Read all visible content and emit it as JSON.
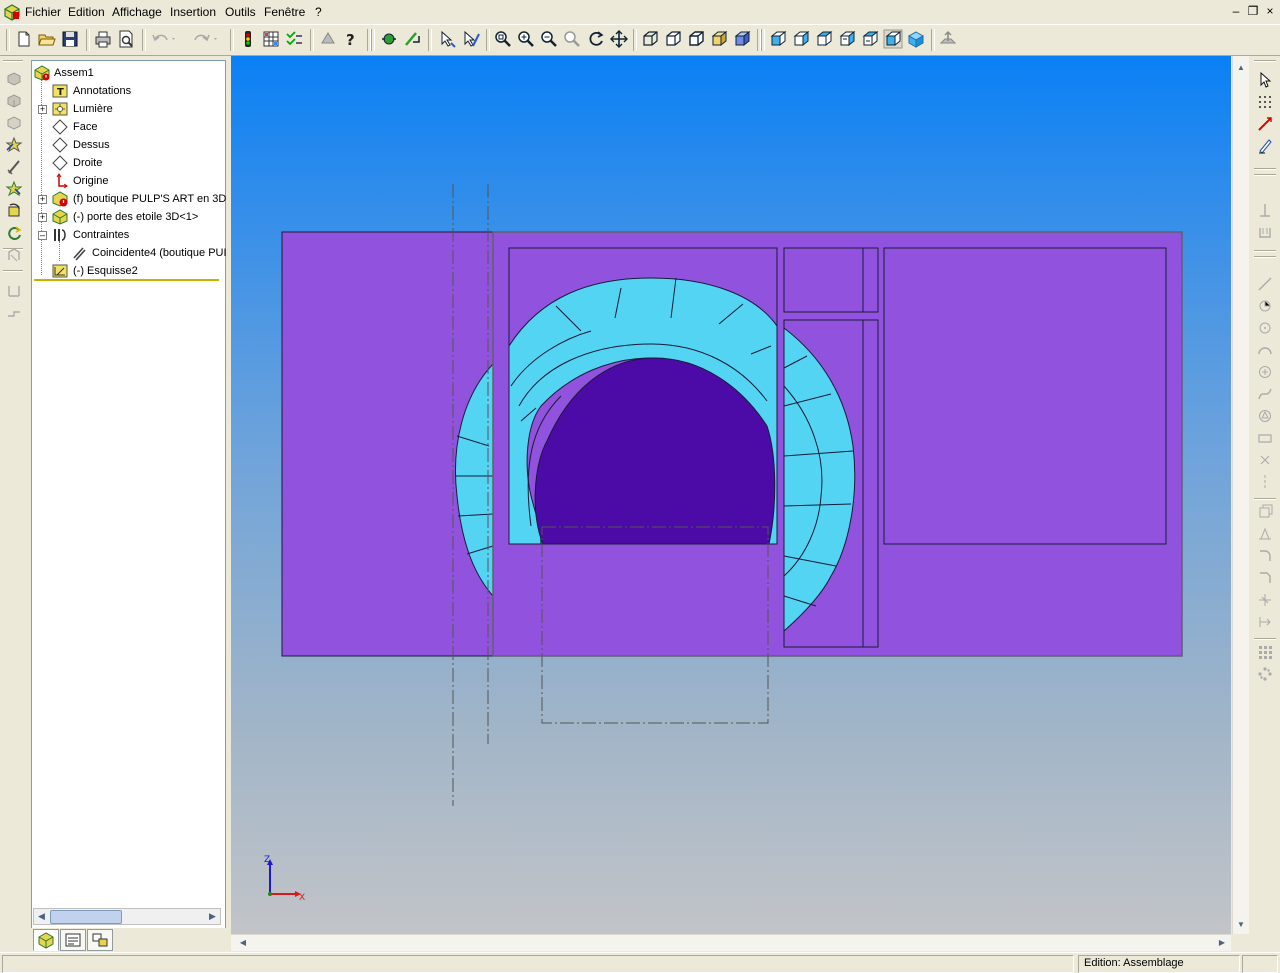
{
  "menubar": {
    "items": [
      "Fichier",
      "Edition",
      "Affichage",
      "Insertion",
      "Outils",
      "Fenêtre",
      "?"
    ]
  },
  "tree": {
    "root": "Assem1",
    "items": [
      {
        "label": "Annotations",
        "icon": "annotations-icon"
      },
      {
        "label": "Lumière",
        "icon": "light-icon"
      },
      {
        "label": "Face",
        "icon": "plane-icon"
      },
      {
        "label": "Dessus",
        "icon": "plane-icon"
      },
      {
        "label": "Droite",
        "icon": "plane-icon"
      },
      {
        "label": "Origine",
        "icon": "origin-icon"
      },
      {
        "label": "(f) boutique PULP'S ART en 3D",
        "icon": "part-icon"
      },
      {
        "label": "(-) porte des etoile 3D<1>",
        "icon": "subassembly-icon"
      },
      {
        "label": "Contraintes",
        "icon": "mates-icon"
      },
      {
        "label": "Coincidente4 (boutique PUI",
        "icon": "coincident-icon"
      },
      {
        "label": "(-) Esquisse2",
        "icon": "sketch-icon"
      }
    ]
  },
  "viewport": {
    "triad_axes": [
      "Z",
      "X"
    ],
    "colors": {
      "wall": "#9152de",
      "ring": "#52d4f2",
      "opening": "#4c0ba6",
      "edge": "#1a1a3a"
    }
  },
  "statusbar": {
    "mode": "Edition: Assemblage"
  }
}
